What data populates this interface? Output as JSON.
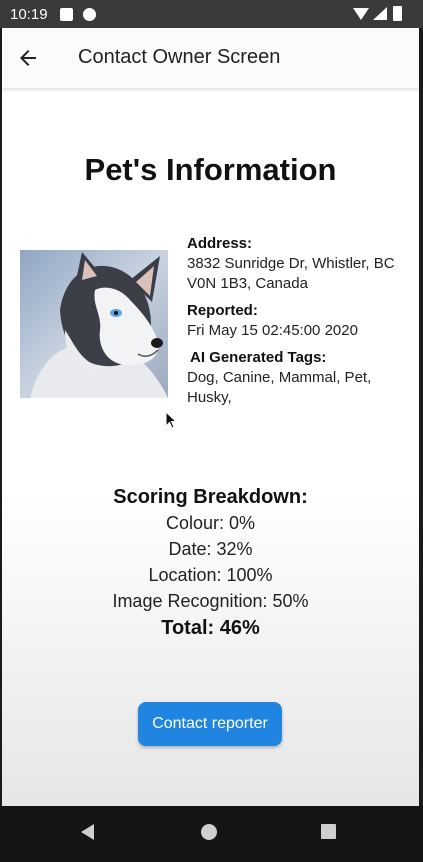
{
  "status_bar": {
    "time": "10:19",
    "icons": [
      "a-notification-icon",
      "p-notification-icon",
      "wifi-icon",
      "signal-icon",
      "battery-icon"
    ]
  },
  "app_bar": {
    "title": "Contact Owner Screen",
    "back_icon": "arrow-left-icon"
  },
  "main": {
    "heading": "Pet's Information",
    "pet_image": "husky-puppy-photo",
    "details": {
      "address_label": "Address:",
      "address_value": "3832 Sunridge Dr, Whistler, BC V0N 1B3, Canada",
      "reported_label": "Reported:",
      "reported_value": "Fri May 15 02:45:00 2020",
      "tags_label": "AI Generated Tags:",
      "tags_value": "Dog, Canine, Mammal, Pet, Husky,"
    },
    "scoring": {
      "title": "Scoring Breakdown:",
      "colour": "Colour: 0%",
      "date": "Date: 32%",
      "location": "Location: 100%",
      "image_recognition": "Image Recognition: 50%",
      "total": "Total: 46%"
    },
    "contact_button_label": "Contact reporter"
  },
  "nav_bar": {
    "icons": [
      "nav-back-icon",
      "nav-home-icon",
      "nav-recents-icon"
    ]
  },
  "colors": {
    "accent": "#1f85e0",
    "status_bar": "#3a3a3a",
    "nav_bar": "#141414"
  }
}
